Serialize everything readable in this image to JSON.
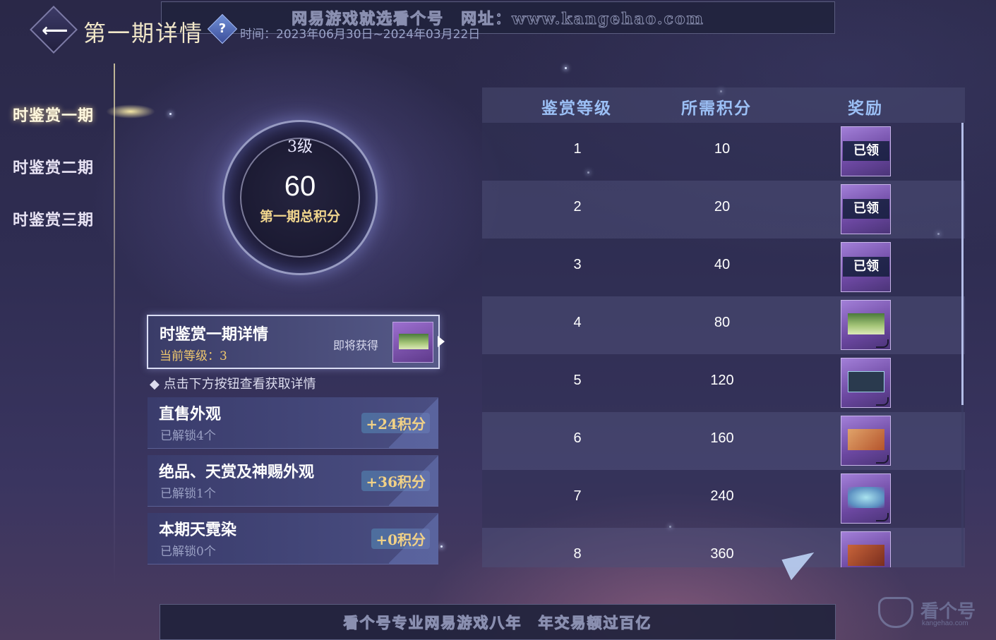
{
  "header": {
    "title": "第一期详情",
    "help_icon": "?",
    "period": "时间：2023年06月30日~2024年03月22日",
    "back_icon": "back-arrow-icon"
  },
  "watermark_top": "网易游戏就选看个号　网址：www.kangehao.com",
  "nav": {
    "items": [
      {
        "label": "时鉴赏一期",
        "active": true
      },
      {
        "label": "时鉴赏二期",
        "active": false
      },
      {
        "label": "时鉴赏三期",
        "active": false
      }
    ]
  },
  "dial": {
    "level": "3级",
    "score": "60",
    "label": "第一期总积分"
  },
  "detail_card": {
    "title": "时鉴赏一期详情",
    "current_level": "当前等级：3",
    "upcoming": "即将获得"
  },
  "hint": "◆ 点击下方按钮查看获取详情",
  "sources": [
    {
      "title": "直售外观",
      "sub": "已解锁4个",
      "points": "+24积分"
    },
    {
      "title": "绝品、天赏及神赐外观",
      "sub": "已解锁1个",
      "points": "+36积分"
    },
    {
      "title": "本期天霓染",
      "sub": "已解锁0个",
      "points": "+0积分"
    }
  ],
  "table": {
    "headers": [
      "鉴赏等级",
      "所需积分",
      "奖励"
    ],
    "rows": [
      {
        "level": "1",
        "points": "10",
        "claimed": "已领"
      },
      {
        "level": "2",
        "points": "20",
        "claimed": "已领"
      },
      {
        "level": "3",
        "points": "40",
        "claimed": "已领"
      },
      {
        "level": "4",
        "points": "80",
        "claimed": ""
      },
      {
        "level": "5",
        "points": "120",
        "claimed": ""
      },
      {
        "level": "6",
        "points": "160",
        "claimed": ""
      },
      {
        "level": "7",
        "points": "240",
        "claimed": ""
      },
      {
        "level": "8",
        "points": "360",
        "claimed": ""
      }
    ]
  },
  "watermark_bottom": "看个号专业网易游戏八年　年交易额过百亿",
  "corner_logo": {
    "name": "看个号",
    "url": "kangehao.com"
  }
}
